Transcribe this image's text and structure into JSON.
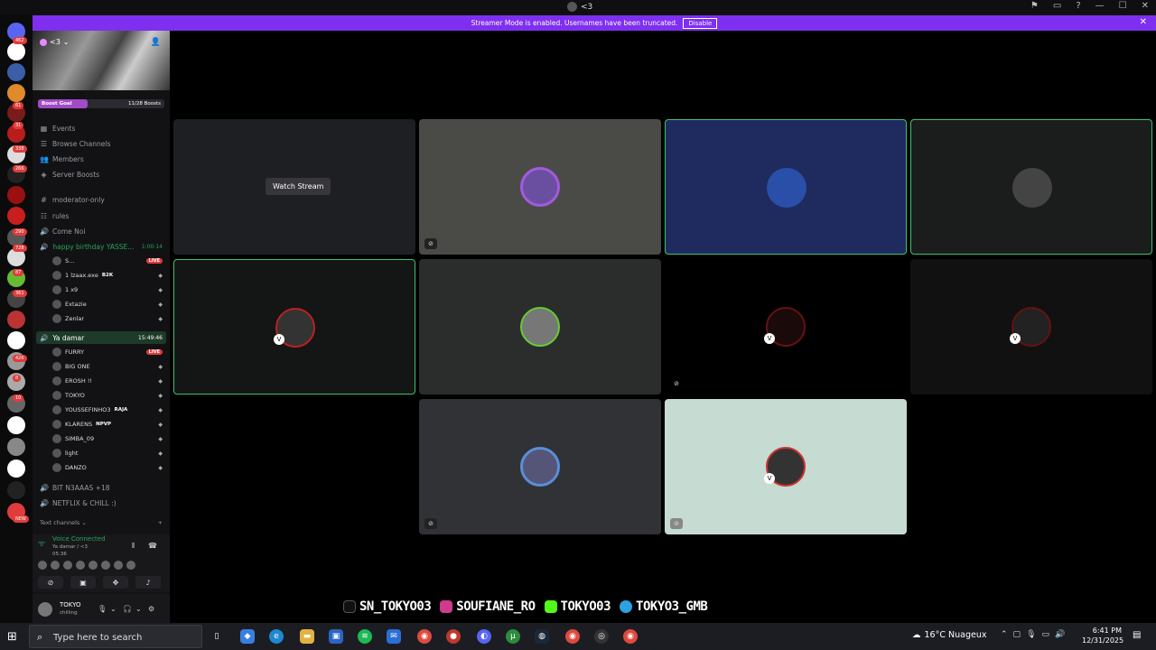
{
  "window": {
    "title": "<3"
  },
  "banner": {
    "text": "Streamer Mode is enabled. Usernames have been truncated.",
    "button": "Disable"
  },
  "guild_badges": [
    "462",
    "61",
    "31",
    "338",
    "266",
    "290",
    "728",
    "87",
    "361",
    "426",
    "8",
    "10",
    "NEW"
  ],
  "server": {
    "name": "<3",
    "boost_goal_label": "Boost Goal",
    "boost_count": "11/28 Boosts",
    "boost_progress": 0.39
  },
  "nav": [
    {
      "label": "Events",
      "icon": "calendar-icon"
    },
    {
      "label": "Browse Channels",
      "icon": "browse-icon"
    },
    {
      "label": "Members",
      "icon": "members-icon"
    },
    {
      "label": "Server Boosts",
      "icon": "boost-icon"
    },
    {
      "label": "moderator-only",
      "icon": "hash-icon"
    },
    {
      "label": "rules",
      "icon": "rules-icon"
    },
    {
      "label": "Come Noi",
      "icon": "speaker-icon"
    }
  ],
  "voice_channels": [
    {
      "name": "happy birthday YASSE...",
      "time": "1:00:14",
      "members": [
        {
          "name": "S...",
          "live": "LIVE"
        },
        {
          "name": "1 lzaax.exe",
          "extra": "B2K"
        },
        {
          "name": "1 x9"
        },
        {
          "name": "Extazie"
        },
        {
          "name": "Zenlar"
        }
      ]
    },
    {
      "name": "Ya damar",
      "time": "15:49:46",
      "members": [
        {
          "name": "FURRY",
          "live": "LIVE"
        },
        {
          "name": "BIG ONE"
        },
        {
          "name": "EROSH !!"
        },
        {
          "name": "TOKYO"
        },
        {
          "name": "YOUSSEFINHO3",
          "extra": "RAJA"
        },
        {
          "name": "KLARENS",
          "extra": "NPVP"
        },
        {
          "name": "SIMBA_09"
        },
        {
          "name": "light"
        },
        {
          "name": "DANZO"
        }
      ]
    }
  ],
  "other_channels": [
    "BIT N3AAAS +18",
    "NETFLIX & CHILL :)"
  ],
  "text_channels_label": "Text channels",
  "voice_panel": {
    "status": "Voice Connected",
    "channel": "Ya damar / <3",
    "timer": "05:36"
  },
  "user": {
    "name": "TOKYO",
    "status": "chilling"
  },
  "grid": {
    "watch_stream": "Watch Stream"
  },
  "socials": [
    "SN_TOKYO03",
    "SOUFIANE_RO",
    "TOKYO03",
    "TOKYO3_GMB"
  ],
  "taskbar": {
    "search_placeholder": "Type here to search",
    "weather": "16°C Nuageux",
    "time": "6:41 PM",
    "date": "12/31/2025"
  },
  "colors": {
    "accent": "#7f2ff0",
    "speaking": "#3bc26e",
    "live": "#e23b3b",
    "voice_green": "#23a55a",
    "tile_blue": "#1f2a5e",
    "tile_mint": "#c6dbd2"
  }
}
